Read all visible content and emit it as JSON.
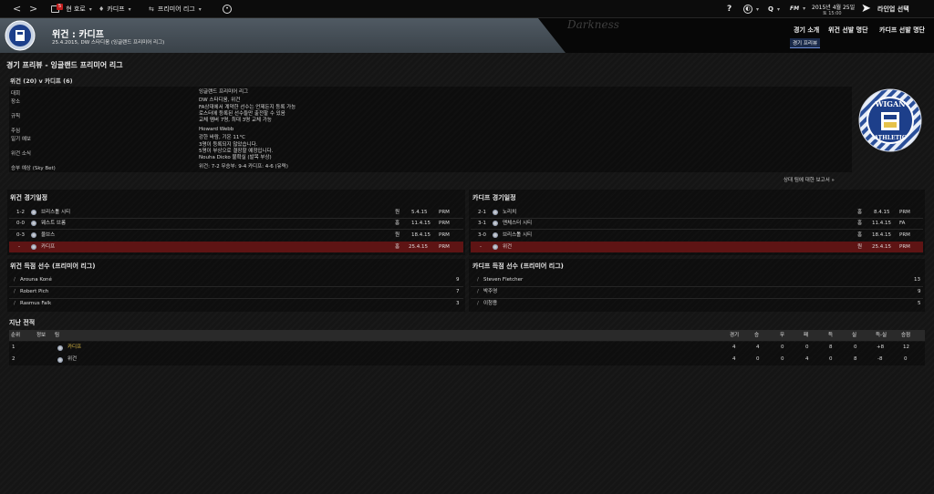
{
  "topbar": {
    "nav_back": "<",
    "nav_fwd": ">",
    "inbox_badge": "5",
    "home_label": "현 호로",
    "club_label": "카디프",
    "league_label": "프리미어 리그",
    "help_icon": "?",
    "search_icon": "Q",
    "fm_label": "FM",
    "date": "2015년 4월 25일",
    "time": "토 15:00",
    "continue_label": "라인업 선택"
  },
  "header": {
    "title": "위건 : 카디프",
    "subtitle": "25.4.2015, DW 스타디움 (잉글랜드 프리미어 리그)",
    "watermark": "Darkness",
    "tabs": [
      "경기 소개",
      "위건 선발 명단",
      "카디프 선발 명단"
    ],
    "subtab": "경기 프리뷰"
  },
  "page": {
    "title": "경기 프리뷰 - 잉글랜드 프리미어 리그",
    "match_title": "위건 (20) v 카디프 (6)",
    "report_link": "상대 팀에 대한 보고서 »"
  },
  "info_rows": [
    {
      "label": "대회",
      "value": "잉글랜드 프리미어 리그"
    },
    {
      "label": "장소",
      "value": "DW 스타디움, 위건"
    },
    {
      "label": "규칙",
      "value": "FA상대에서 계약한 선수는 언제든지 등록 가능\n로스터에 등록된 선수들만 출전할 수 있음\n교체 멤버 7명, 최대 3명 교체 가능"
    },
    {
      "label": "주심",
      "value": "Howard Webb"
    },
    {
      "label": "일기 예보",
      "value": "강한 바람, 기온 11°C"
    },
    {
      "label": "위건 소식",
      "value": "3명이 등록되지 않았습니다.\n5명이 부상으로 결장할 예정입니다.\nNouha Dicko 불확실 (발목 부상)"
    },
    {
      "label": "승부 예상 (Sky Bet)",
      "value": "위건: 7-2  무승부: 9-4  카디프: 4-6 (유력)"
    }
  ],
  "wigan_fixtures": {
    "title": "위건 경기일정",
    "rows": [
      {
        "score": "1-2",
        "team": "브리스톨 시티",
        "venue": "원",
        "date": "5.4.15",
        "comp": "PRM"
      },
      {
        "score": "0-0",
        "team": "웨스트 브롬",
        "venue": "홈",
        "date": "11.4.15",
        "comp": "PRM"
      },
      {
        "score": "0-3",
        "team": "울브스",
        "venue": "원",
        "date": "18.4.15",
        "comp": "PRM"
      },
      {
        "score": "-",
        "team": "카디프",
        "venue": "홈",
        "date": "25.4.15",
        "comp": "PRM"
      }
    ]
  },
  "cardiff_fixtures": {
    "title": "카디프 경기일정",
    "rows": [
      {
        "score": "2-1",
        "team": "노리치",
        "venue": "홈",
        "date": "8.4.15",
        "comp": "PRM"
      },
      {
        "score": "3-1",
        "team": "맨체스터 시티",
        "venue": "홈",
        "date": "11.4.15",
        "comp": "FA"
      },
      {
        "score": "3-0",
        "team": "브리스톨 시티",
        "venue": "홈",
        "date": "18.4.15",
        "comp": "PRM"
      },
      {
        "score": "-",
        "team": "위건",
        "venue": "원",
        "date": "25.4.15",
        "comp": "PRM"
      }
    ]
  },
  "wigan_scorers": {
    "title": "위건 득점 선수 (프리미어 리그)",
    "rows": [
      {
        "name": "Arouna Koné",
        "goals": "9"
      },
      {
        "name": "Robert Pich",
        "goals": "7"
      },
      {
        "name": "Rasmus Falk",
        "goals": "3"
      }
    ]
  },
  "cardiff_scorers": {
    "title": "카디프 득점 선수 (프리미어 리그)",
    "rows": [
      {
        "name": "Steven Fletcher",
        "goals": "13"
      },
      {
        "name": "박주영",
        "goals": "9"
      },
      {
        "name": "이청용",
        "goals": "5"
      }
    ]
  },
  "history": {
    "title": "지난 전적",
    "columns": [
      "순위",
      "정보",
      "팀",
      "경기",
      "승",
      "무",
      "패",
      "득",
      "실",
      "득-실",
      "승점"
    ],
    "rows": [
      {
        "pos": "1",
        "team": "카디프",
        "p": "4",
        "w": "4",
        "d": "0",
        "l": "0",
        "gf": "8",
        "ga": "0",
        "gd": "+8",
        "pts": "12"
      },
      {
        "pos": "2",
        "team": "위건",
        "p": "4",
        "w": "0",
        "d": "0",
        "l": "4",
        "gf": "0",
        "ga": "8",
        "gd": "-8",
        "pts": "0"
      }
    ]
  },
  "crest": {
    "top_text": "WIGAN",
    "bottom_text": "ATHLETIC",
    "year": "1932"
  },
  "colors": {
    "highlight_row": "#5e1414",
    "header_grey": "#4a535b",
    "accent_blue": "#6c8cd6",
    "cardiff_team_text": "#e6c24a"
  }
}
